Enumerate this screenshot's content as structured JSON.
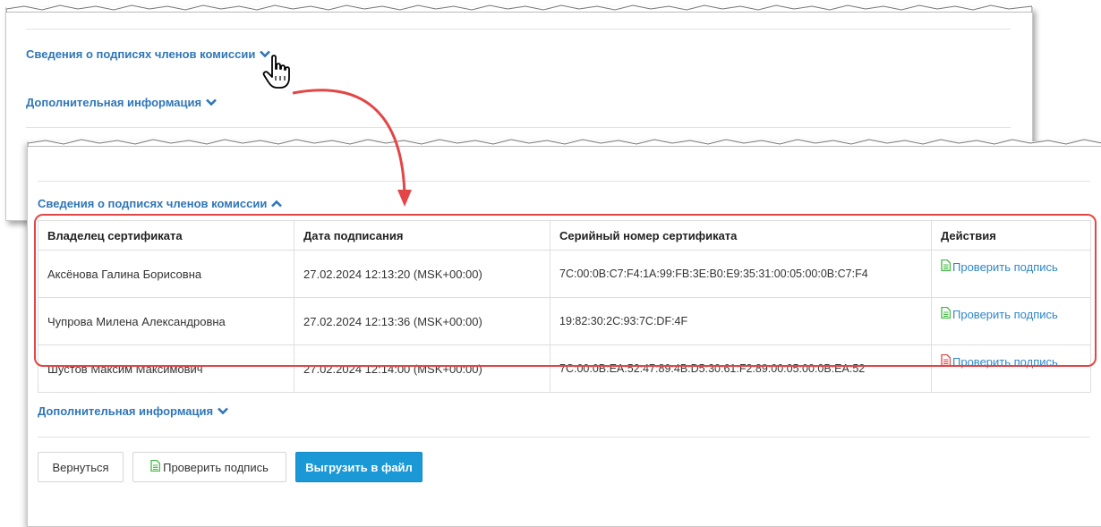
{
  "back_panel": {
    "section_signatures": "Сведения о подписях членов комиссии",
    "section_additional": "Дополнительная информация"
  },
  "front_panel": {
    "section_signatures": "Сведения о подписях членов комиссии",
    "section_additional": "Дополнительная информация",
    "table": {
      "headers": [
        "Владелец сертификата",
        "Дата подписания",
        "Серийный номер сертификата",
        "Действия"
      ],
      "rows": [
        {
          "owner": "Аксёнова Галина Борисовна",
          "date": "27.02.2024 12:13:20 (MSK+00:00)",
          "serial": "7C:00:0B:C7:F4:1A:99:FB:3E:B0:E9:35:31:00:05:00:0B:C7:F4",
          "action": "Проверить подпись",
          "status_color": "#3fb83f"
        },
        {
          "owner": "Чупрова Милена Александровна",
          "date": "27.02.2024 12:13:36 (MSK+00:00)",
          "serial": "19:82:30:2C:93:7C:DF:4F",
          "action": "Проверить подпись",
          "status_color": "#3fb83f"
        },
        {
          "owner": "Шустов Максим Максимович",
          "date": "27.02.2024 12:14:00 (MSK+00:00)",
          "serial": "7C:00:0B:EA:52:47:89:4B:D5:30:61:F2:89:00:05:00:0B:EA:52",
          "action": "Проверить подпись",
          "status_color": "#e04545"
        }
      ]
    },
    "buttons": {
      "back": "Вернуться",
      "verify": "Проверить подпись",
      "export": "Выгрузить в файл"
    }
  },
  "colors": {
    "link": "#2f76b7",
    "primary": "#1b98d6",
    "highlight": "#e34646",
    "ok_icon": "#3fb83f",
    "error_icon": "#e04545"
  }
}
